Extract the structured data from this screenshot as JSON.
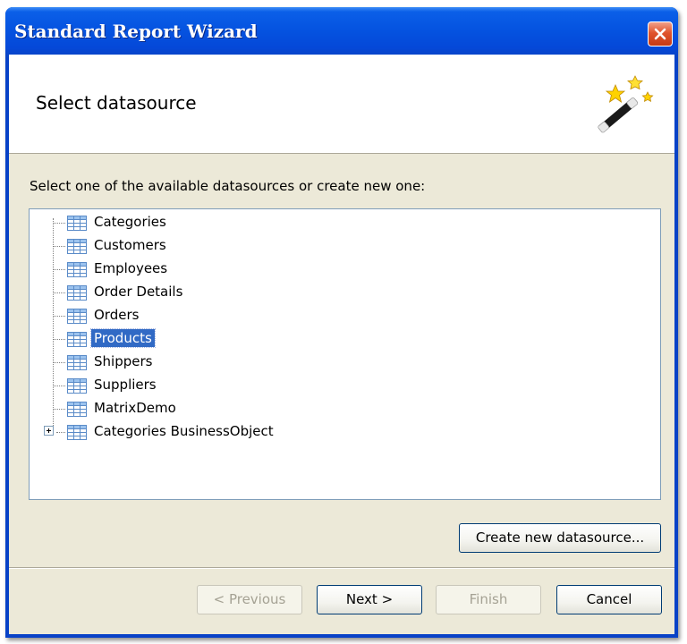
{
  "window": {
    "title": "Standard Report Wizard"
  },
  "header": {
    "title": "Select datasource",
    "icon": "magic-wand-icon"
  },
  "instruction": "Select one of the available datasources or create new one:",
  "tree": {
    "items": [
      {
        "label": "Categories",
        "selected": false,
        "expandable": false
      },
      {
        "label": "Customers",
        "selected": false,
        "expandable": false
      },
      {
        "label": "Employees",
        "selected": false,
        "expandable": false
      },
      {
        "label": "Order Details",
        "selected": false,
        "expandable": false
      },
      {
        "label": "Orders",
        "selected": false,
        "expandable": false
      },
      {
        "label": "Products",
        "selected": true,
        "expandable": false
      },
      {
        "label": "Shippers",
        "selected": false,
        "expandable": false
      },
      {
        "label": "Suppliers",
        "selected": false,
        "expandable": false
      },
      {
        "label": "MatrixDemo",
        "selected": false,
        "expandable": false
      },
      {
        "label": "Categories BusinessObject",
        "selected": false,
        "expandable": true
      }
    ]
  },
  "buttons": {
    "create_new": "Create new datasource...",
    "previous": "< Previous",
    "next": "Next >",
    "finish": "Finish",
    "cancel": "Cancel"
  },
  "colors": {
    "titlebar": "#0553e0",
    "selection": "#316ac5",
    "dialog_face": "#ece9d8"
  }
}
